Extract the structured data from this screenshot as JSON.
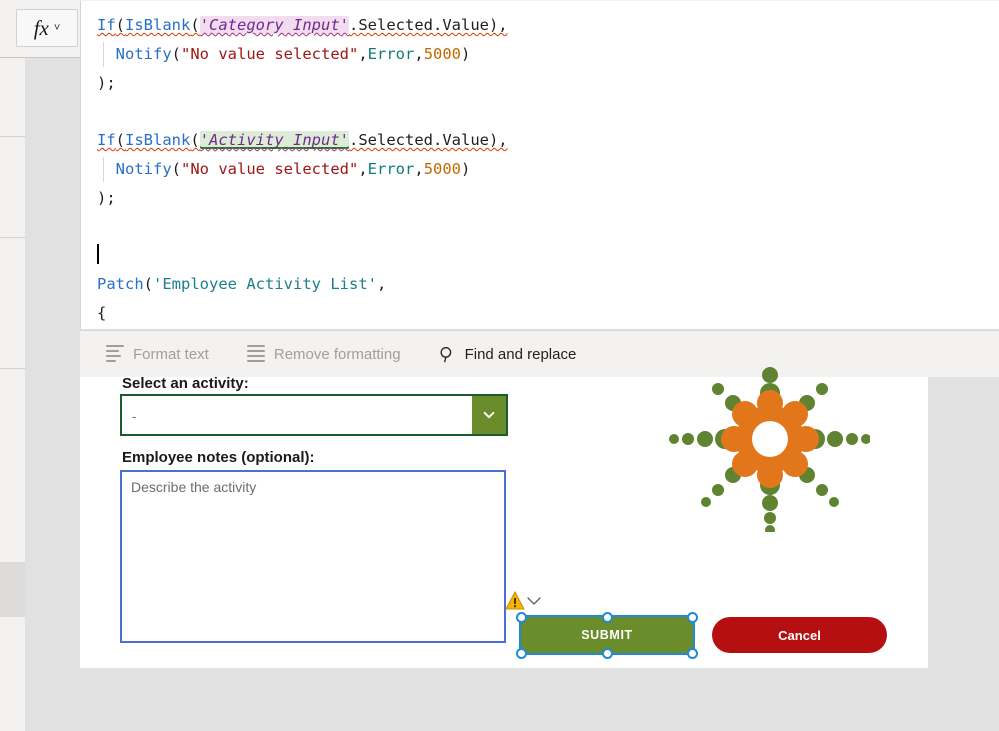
{
  "formula_bar": {
    "fx_label": "fx",
    "caret_icon": "chevron-down-icon"
  },
  "editor": {
    "language": "Power Fx",
    "lines": [
      {
        "tokens": [
          {
            "t": "If",
            "c": "kw"
          },
          {
            "t": "(",
            "c": "plain"
          },
          {
            "t": "IsBlank",
            "c": "kw"
          },
          {
            "t": "(",
            "c": "plain"
          },
          {
            "t": "'Category Input'",
            "c": "ident-pink"
          },
          {
            "t": ".Selected.Value),",
            "c": "plain"
          }
        ]
      },
      {
        "indent": true,
        "tokens": [
          {
            "t": "Notify",
            "c": "kw"
          },
          {
            "t": "(",
            "c": "plain"
          },
          {
            "t": "\"No value selected\"",
            "c": "str"
          },
          {
            "t": ",",
            "c": "plain"
          },
          {
            "t": "Error",
            "c": "err"
          },
          {
            "t": ",",
            "c": "plain"
          },
          {
            "t": "5000",
            "c": "num"
          },
          {
            "t": ")",
            "c": "plain"
          }
        ]
      },
      {
        "tokens": [
          {
            "t": ");",
            "c": "plain"
          }
        ]
      },
      {
        "tokens": []
      },
      {
        "tokens": [
          {
            "t": "If",
            "c": "kw"
          },
          {
            "t": "(",
            "c": "plain"
          },
          {
            "t": "IsBlank",
            "c": "kw"
          },
          {
            "t": "(",
            "c": "plain"
          },
          {
            "t": "'Activity Input'",
            "c": "ident-green"
          },
          {
            "t": ".Selected.Value),",
            "c": "plain"
          }
        ]
      },
      {
        "indent": true,
        "tokens": [
          {
            "t": "Notify",
            "c": "kw"
          },
          {
            "t": "(",
            "c": "plain"
          },
          {
            "t": "\"No value selected\"",
            "c": "str"
          },
          {
            "t": ",",
            "c": "plain"
          },
          {
            "t": "Error",
            "c": "err"
          },
          {
            "t": ",",
            "c": "plain"
          },
          {
            "t": "5000",
            "c": "num"
          },
          {
            "t": ")",
            "c": "plain"
          }
        ]
      },
      {
        "tokens": [
          {
            "t": ");",
            "c": "plain"
          }
        ]
      },
      {
        "tokens": []
      },
      {
        "caret": true,
        "tokens": []
      },
      {
        "tokens": [
          {
            "t": "Patch",
            "c": "kw"
          },
          {
            "t": "(",
            "c": "plain"
          },
          {
            "t": "'Employee Activity List'",
            "c": "fn"
          },
          {
            "t": ",",
            "c": "plain"
          }
        ]
      },
      {
        "tokens": [
          {
            "t": "{",
            "c": "plain"
          }
        ]
      }
    ]
  },
  "editor_toolbar": {
    "items": [
      {
        "label": "Format text",
        "icon": "format-text-icon",
        "enabled": false
      },
      {
        "label": "Remove formatting",
        "icon": "remove-formatting-icon",
        "enabled": false
      },
      {
        "label": "Find and replace",
        "icon": "search-icon",
        "enabled": true
      }
    ]
  },
  "form": {
    "activity": {
      "label": "Select an activity:",
      "value": "-",
      "chevron_icon": "chevron-down-icon",
      "border_color": "#1a5c2e",
      "button_color": "#6b8c2a"
    },
    "notes": {
      "label": "Employee notes (optional):",
      "placeholder": "Describe the activity",
      "value": "",
      "border_color": "#4a6fd4"
    },
    "logo": {
      "name": "starburst-logo",
      "center_color": "#e2761b",
      "dot_color": "#5f8331"
    },
    "buttons": {
      "submit": {
        "label": "SUBMIT",
        "color": "#6b8c2a",
        "selected": true
      },
      "cancel": {
        "label": "Cancel",
        "color": "#b60f12"
      }
    },
    "warning": {
      "icon": "warning-triangle-icon",
      "chevron_icon": "chevron-down-icon",
      "color": "#f5b400"
    }
  }
}
